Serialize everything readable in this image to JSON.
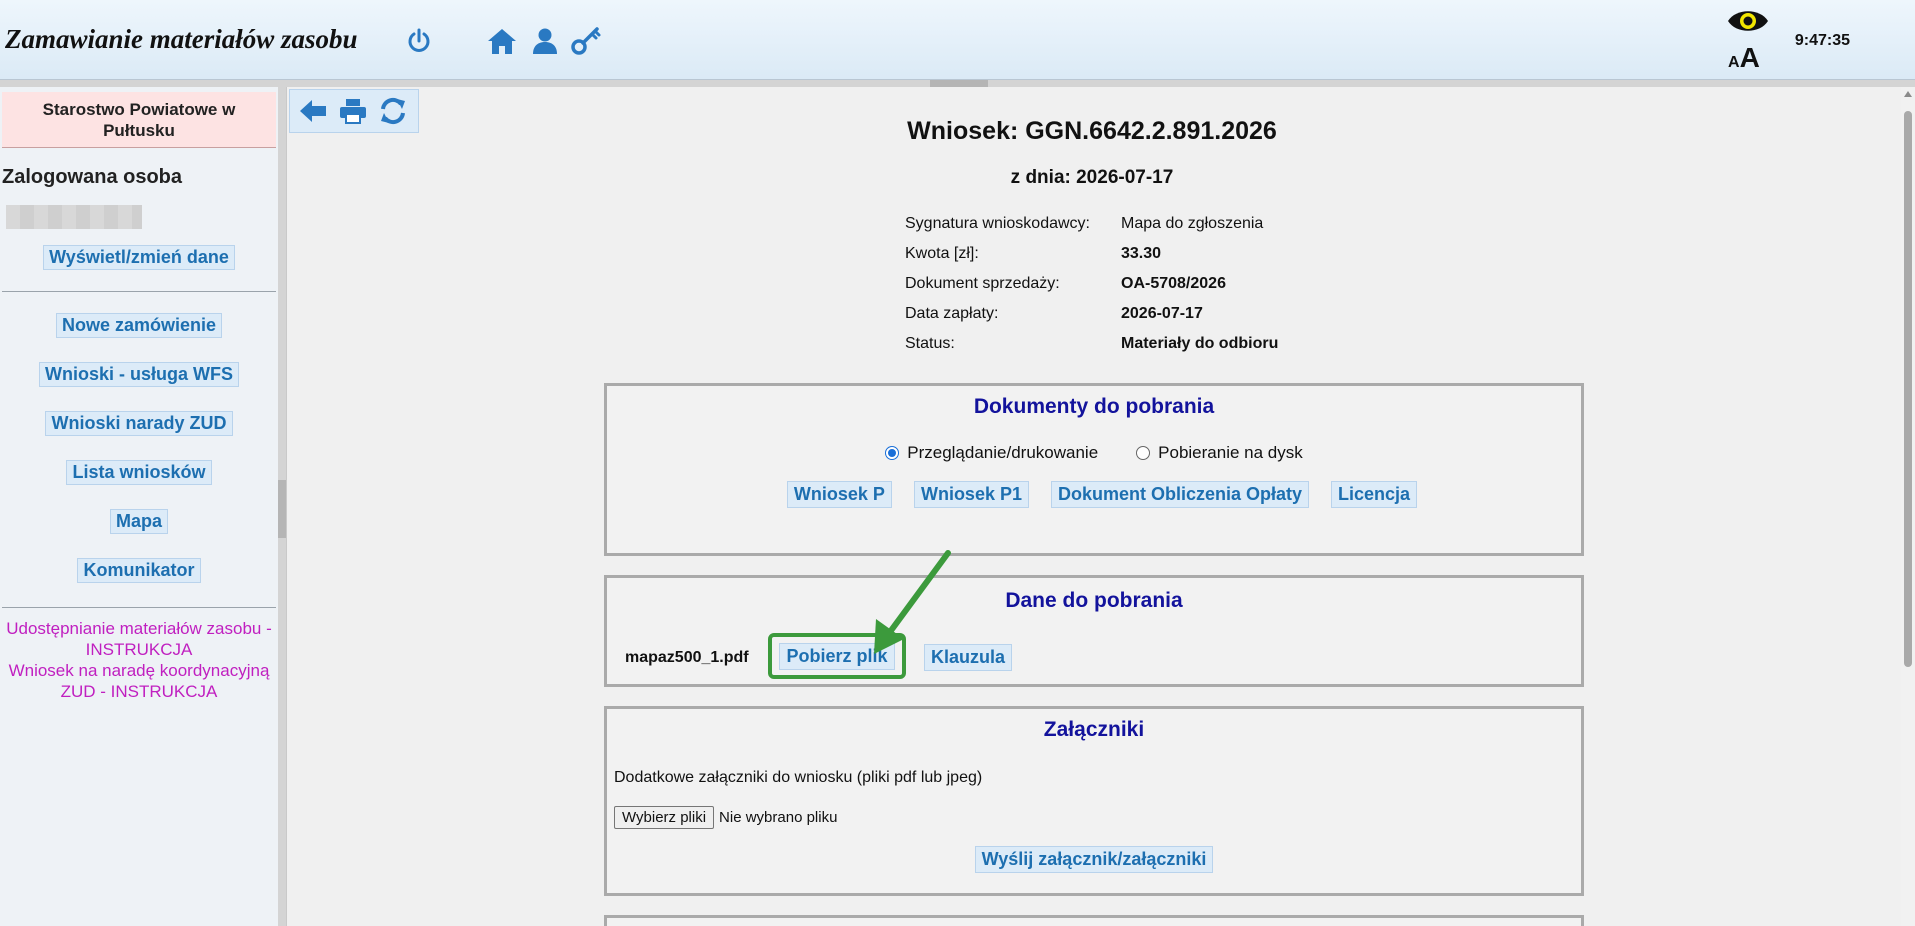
{
  "header": {
    "title": "Zamawianie materiałów zasobu",
    "clock": "9:47:35",
    "font_size_small": "A",
    "font_size_big": "A",
    "icons": [
      "power-icon",
      "home-icon",
      "user-icon",
      "key-icon",
      "eye-icon"
    ]
  },
  "sidebar": {
    "org_name": "Starostwo Powiatowe w Pułtusku",
    "logged_label": "Zalogowana osoba",
    "edit_data": "Wyświetl/zmień dane",
    "menu": [
      "Nowe zamówienie",
      "Wnioski - usługa WFS",
      "Wnioski narady ZUD",
      "Lista wniosków",
      "Mapa",
      "Komunikator"
    ],
    "links": [
      "Udostępnianie materiałów zasobu - INSTRUKCJA",
      "Wniosek na naradę koordynacyjną ZUD - INSTRUKCJA"
    ]
  },
  "toolbar": {
    "icons": [
      "back-arrow-icon",
      "print-icon",
      "refresh-icon"
    ]
  },
  "request": {
    "title": "Wniosek: GGN.6642.2.891.2026",
    "date": "z dnia: 2026-07-17",
    "fields": [
      {
        "label": "Sygnatura wnioskodawcy:",
        "value": "Mapa do zgłoszenia"
      },
      {
        "label": "Kwota [zł]:",
        "value": "33.30"
      },
      {
        "label": "Dokument sprzedaży:",
        "value": "OA-5708/2026"
      },
      {
        "label": "Data zapłaty:",
        "value": "2026-07-17"
      },
      {
        "label": "Status:",
        "value": "Materiały do odbioru"
      }
    ]
  },
  "documents": {
    "title": "Dokumenty do pobrania",
    "radio_view": "Przeglądanie/drukowanie",
    "radio_download": "Pobieranie na dysk",
    "selected": "Przeglądanie/drukowanie",
    "buttons": [
      "Wniosek P",
      "Wniosek P1",
      "Dokument Obliczenia Opłaty",
      "Licencja"
    ]
  },
  "data_download": {
    "title": "Dane do pobrania",
    "file_name": "mapaz500_1.pdf",
    "download_button": "Pobierz plik",
    "clause_button": "Klauzula",
    "highlight_color": "#3c9a3c"
  },
  "attachments": {
    "title": "Załączniki",
    "description": "Dodatkowe załączniki do wniosku (pliki pdf lub jpeg)",
    "choose_button": "Wybierz pliki",
    "no_file": "Nie wybrano pliku",
    "send_button": "Wyślij załącznik/załączniki"
  },
  "colors": {
    "link_blue": "#1d6fb0",
    "panel_title": "#13139c",
    "instruction_magenta": "#c020c0",
    "org_bg": "#fde3e3"
  }
}
